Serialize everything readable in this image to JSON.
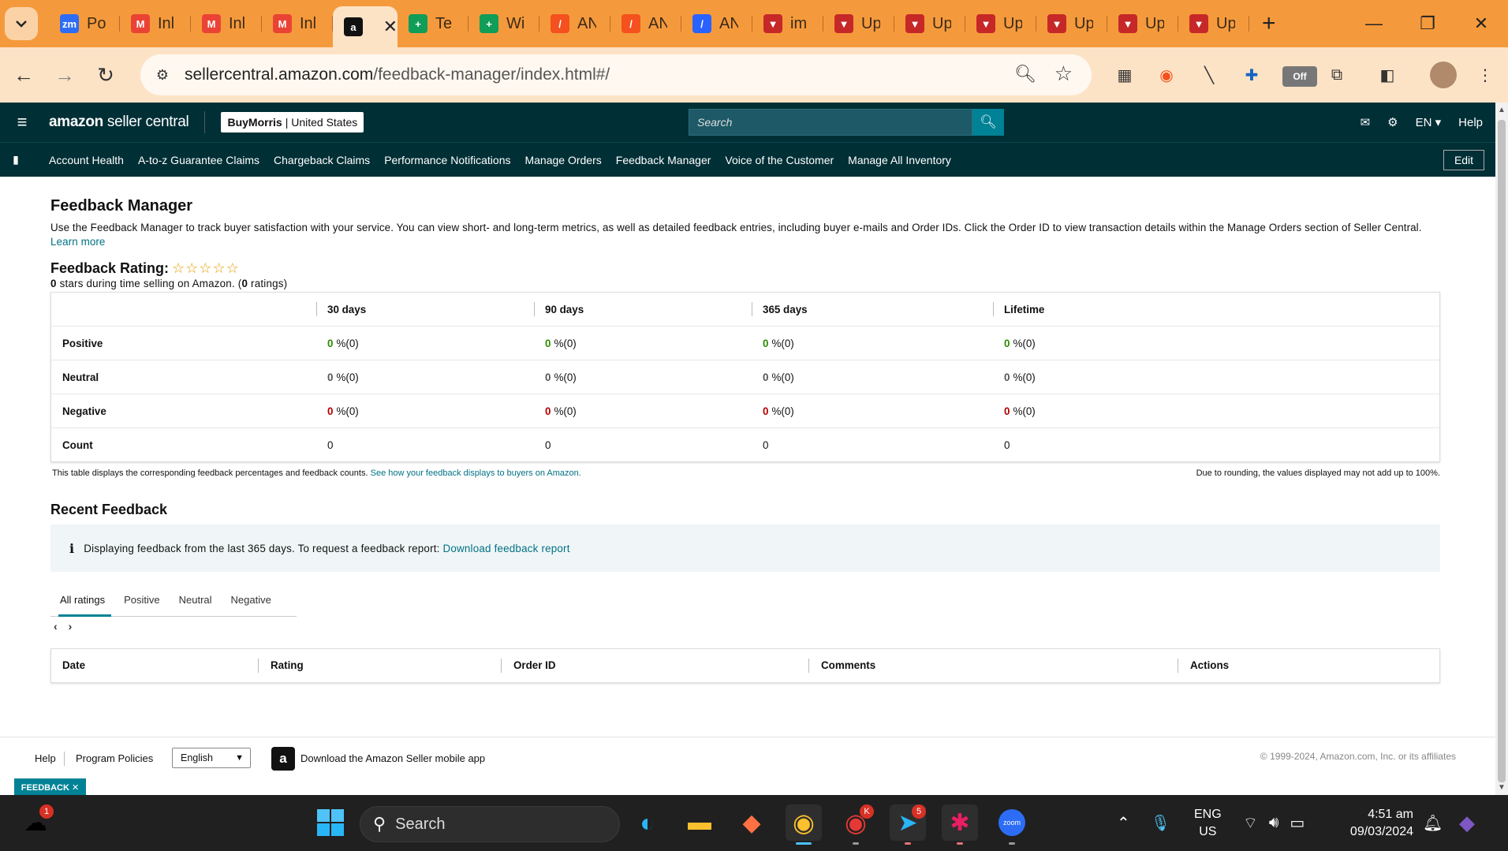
{
  "browser": {
    "tabs": [
      {
        "title": "Po",
        "icon": "zoom-icon",
        "color": "#2d6df6",
        "glyph": "zm"
      },
      {
        "title": "Inl",
        "icon": "gmail-icon",
        "color": "#ea4335",
        "glyph": "M"
      },
      {
        "title": "Inl",
        "icon": "gmail-icon",
        "color": "#ea4335",
        "glyph": "M"
      },
      {
        "title": "Inl",
        "icon": "gmail-icon",
        "color": "#ea4335",
        "glyph": "M"
      },
      {
        "title": "",
        "icon": "amazon-icon",
        "color": "#111111",
        "glyph": "a",
        "active": true
      },
      {
        "title": "Te",
        "icon": "sheets-icon",
        "color": "#0f9d58",
        "glyph": "+"
      },
      {
        "title": "Wi",
        "icon": "sheets-icon",
        "color": "#0f9d58",
        "glyph": "+"
      },
      {
        "title": "AN",
        "icon": "pen-icon",
        "color": "#f4511e",
        "glyph": "/"
      },
      {
        "title": "AN",
        "icon": "pen-icon",
        "color": "#f4511e",
        "glyph": "/"
      },
      {
        "title": "AN",
        "icon": "pen-icon",
        "color": "#2962ff",
        "glyph": "/"
      },
      {
        "title": "im",
        "icon": "shield-app-icon",
        "color": "#c62828",
        "glyph": "▼"
      },
      {
        "title": "Up",
        "icon": "shield-app-icon",
        "color": "#c62828",
        "glyph": "▼"
      },
      {
        "title": "Up",
        "icon": "shield-app-icon",
        "color": "#c62828",
        "glyph": "▼"
      },
      {
        "title": "Up",
        "icon": "shield-app-icon",
        "color": "#c62828",
        "glyph": "▼"
      },
      {
        "title": "Up",
        "icon": "shield-app-icon",
        "color": "#c62828",
        "glyph": "▼"
      },
      {
        "title": "Up",
        "icon": "shield-app-icon",
        "color": "#c62828",
        "glyph": "▼"
      },
      {
        "title": "Up",
        "icon": "shield-app-icon",
        "color": "#c62828",
        "glyph": "▼"
      }
    ],
    "url_host": "sellercentral.amazon.com",
    "url_path": "/feedback-manager/index.html#/",
    "ext_off_label": "Off"
  },
  "sc": {
    "logo_bold": "amazon",
    "logo_rest": " seller central",
    "account_name": "BuyMorris",
    "account_region": "| United States",
    "search_placeholder": "Search",
    "lang": "EN",
    "help": "Help",
    "nav": [
      "Account Health",
      "A-to-z Guarantee Claims",
      "Chargeback Claims",
      "Performance Notifications",
      "Manage Orders",
      "Feedback Manager",
      "Voice of the Customer",
      "Manage All Inventory"
    ],
    "edit": "Edit"
  },
  "page": {
    "title": "Feedback Manager",
    "intro": "Use the Feedback Manager to track buyer satisfaction with your service. You can view short- and long-term metrics, as well as detailed feedback entries, including buyer e-mails and Order IDs. Click the Order ID to view transaction details within the Manage Orders section of Seller Central.",
    "learn_more": "Learn more",
    "rating_title": "Feedback Rating:",
    "stars": "☆☆☆☆☆",
    "rating_stars_value": "0",
    "rating_sub_mid": " stars during time selling on Amazon. (",
    "rating_count": "0",
    "rating_sub_end": " ratings)",
    "table": {
      "headers": [
        "30 days",
        "90 days",
        "365 days",
        "Lifetime"
      ],
      "rows": [
        {
          "label": "Positive",
          "kind": "pos",
          "values": [
            "0",
            "0",
            "0",
            "0"
          ],
          "suffix": "%(0)"
        },
        {
          "label": "Neutral",
          "kind": "neu",
          "values": [
            "0",
            "0",
            "0",
            "0"
          ],
          "suffix": "%(0)"
        },
        {
          "label": "Negative",
          "kind": "neg",
          "values": [
            "0",
            "0",
            "0",
            "0"
          ],
          "suffix": "%(0)"
        },
        {
          "label": "Count",
          "kind": "count",
          "values": [
            "0",
            "0",
            "0",
            "0"
          ],
          "suffix": ""
        }
      ]
    },
    "note_left": "This table displays the corresponding feedback percentages and feedback counts.",
    "note_left_link": "See how your feedback displays to buyers on Amazon.",
    "note_right": "Due to rounding, the values displayed may not add up to 100%.",
    "recent_title": "Recent Feedback",
    "info_text": "Displaying feedback from the last 365 days. To request a feedback report:",
    "info_link": "Download feedback report",
    "filters": [
      "All ratings",
      "Positive",
      "Neutral",
      "Negative"
    ],
    "recent_headers": [
      "Date",
      "Rating",
      "Order ID",
      "Comments",
      "Actions"
    ]
  },
  "footer": {
    "help": "Help",
    "policies": "Program Policies",
    "language": "English",
    "app": "Download the Amazon Seller mobile app",
    "copyright": "© 1999-2024, Amazon.com, Inc. or its affiliates",
    "feedback": "FEEDBACK ✕"
  },
  "taskbar": {
    "search": "Search",
    "lang1": "ENG",
    "lang2": "US",
    "time": "4:51 am",
    "date": "09/03/2024",
    "weather_badge": "1",
    "chrome_badge": "K",
    "telegram_badge": "5"
  }
}
